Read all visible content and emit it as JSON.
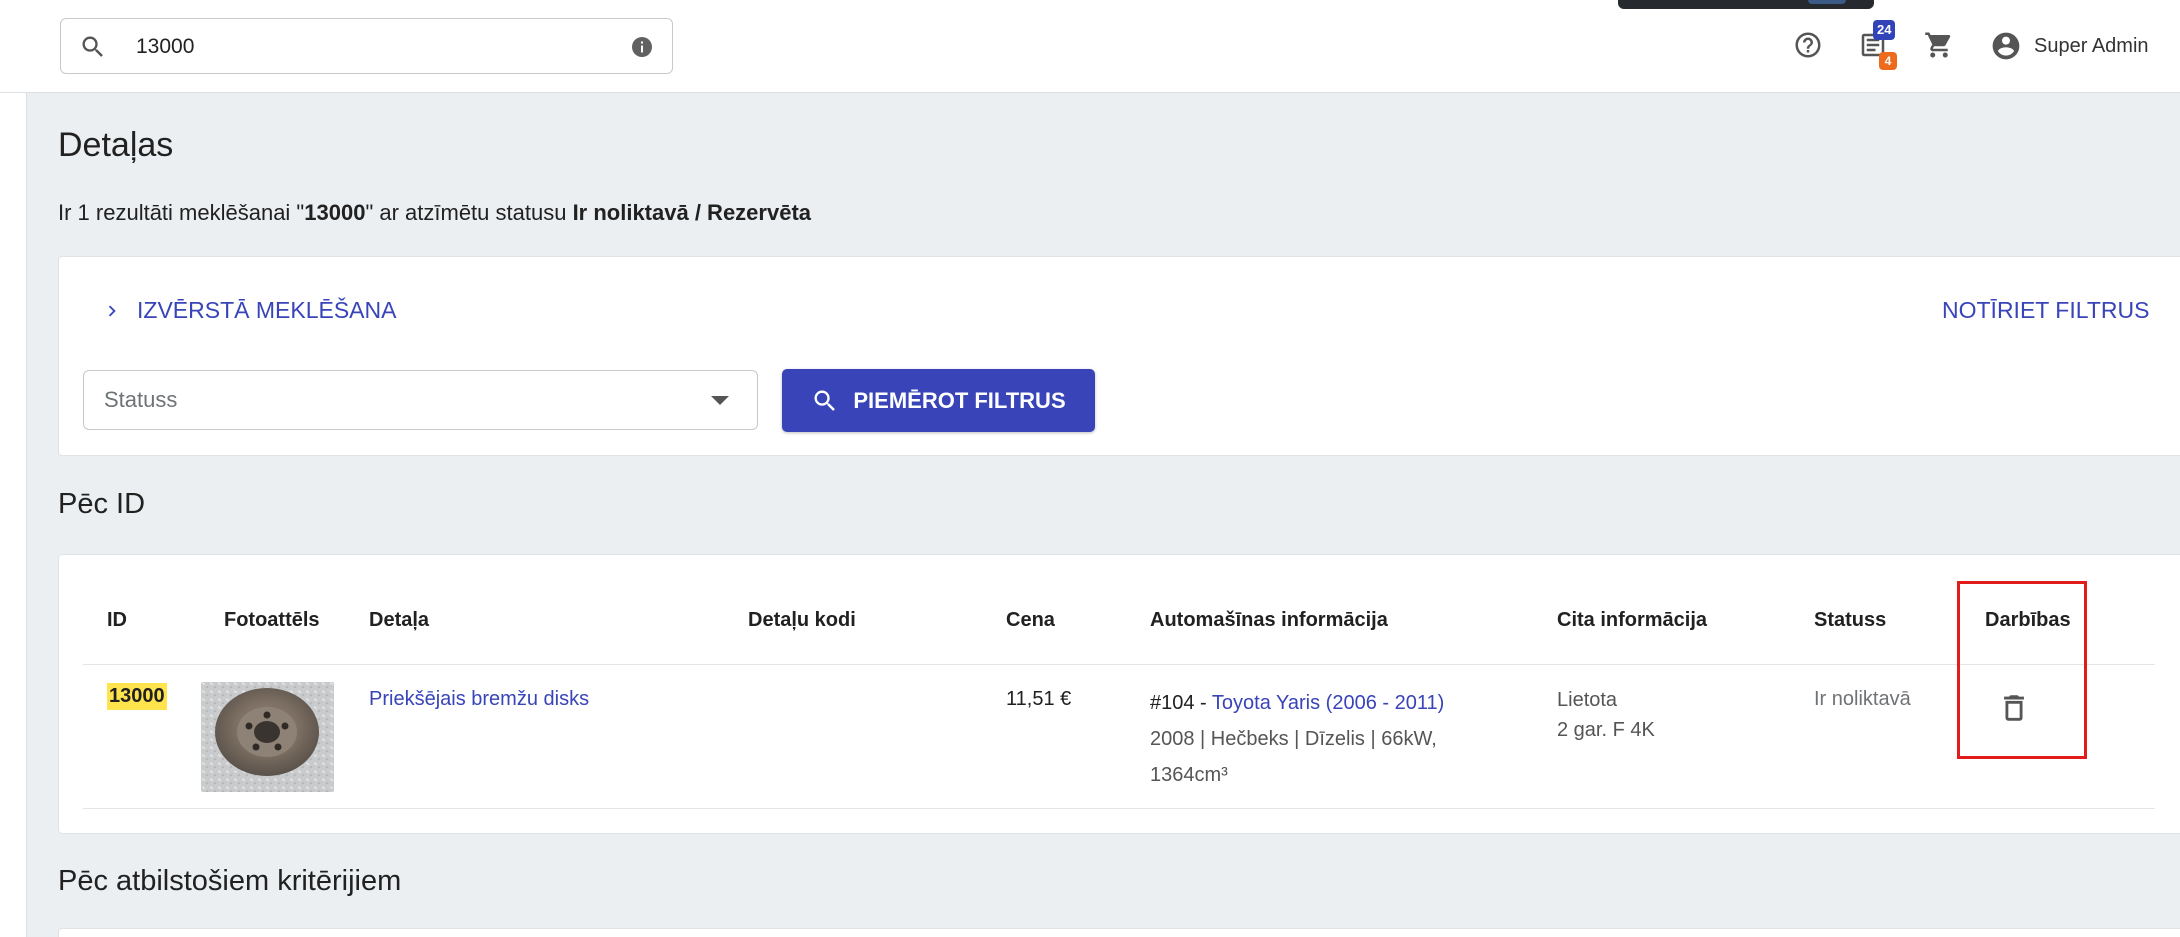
{
  "topbar": {
    "search": {
      "value": "13000",
      "icon": "search-icon",
      "info_icon": "info-icon"
    },
    "icons": [
      "help-icon",
      "notifications-icon",
      "cart-icon"
    ],
    "badges": {
      "primary": "24",
      "secondary": "4",
      "primary_color": "#3242b8",
      "secondary_color": "#ee6a1c"
    },
    "user": {
      "name": "Super Admin",
      "icon": "account-circle-icon"
    }
  },
  "page": {
    "title": "Detaļas",
    "result_prefix": "Ir 1 rezultāti meklēšanai \"",
    "result_query": "13000",
    "result_middle": "\" ar atzīmētu statusu ",
    "result_status": "Ir noliktavā / Rezervēta"
  },
  "filters": {
    "advanced_search": "IZVĒRSTĀ MEKLĒŠANA",
    "clear": "NOTĪRIET FILTRUS",
    "status_placeholder": "Statuss",
    "apply": "PIEMĒROT FILTRUS"
  },
  "by_id": {
    "title": "Pēc ID",
    "columns": [
      "ID",
      "Fotoattēls",
      "Detaļa",
      "Detaļu kodi",
      "Cena",
      "Automašīnas informācija",
      "Cita informācija",
      "Statuss",
      "Darbības"
    ],
    "rows": [
      {
        "id": "13000",
        "part": "Priekšējais bremžu disks",
        "codes": "",
        "price": "11,51 €",
        "car_number": "#104 - ",
        "car_link": "Toyota Yaris (2006 - 2011)",
        "car_details_1": "2008 | Hečbeks | Dīzelis | 66kW,",
        "car_details_2": "1364cm³",
        "other_1": "Lietota",
        "other_2": "2 gar. F 4K",
        "status": "Ir noliktavā",
        "action_icon": "delete-icon"
      }
    ]
  },
  "by_criteria": {
    "title": "Pēc atbilstošiem kritērijiem"
  },
  "colors": {
    "accent": "#3844b8",
    "highlight": "#ffe44d",
    "annotation": "#e21b1b",
    "background": "#eceff1"
  }
}
